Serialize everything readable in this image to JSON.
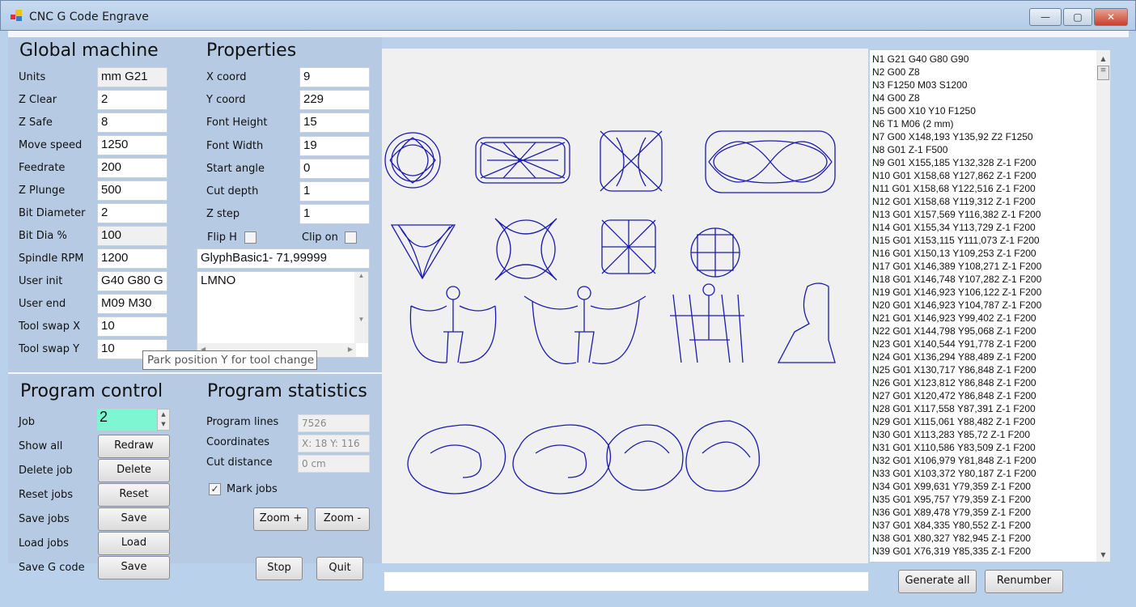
{
  "window": {
    "title": "CNC G Code Engrave",
    "minimize": "—",
    "maximize": "▢",
    "close": "✕"
  },
  "global": {
    "heading": "Global machine",
    "fields": [
      {
        "label": "Units",
        "value": "mm G21",
        "readonly": true
      },
      {
        "label": "Z Clear",
        "value": "2"
      },
      {
        "label": "Z Safe",
        "value": "8"
      },
      {
        "label": "Move speed",
        "value": "1250"
      },
      {
        "label": "Feedrate",
        "value": "200"
      },
      {
        "label": "Z Plunge",
        "value": "500"
      },
      {
        "label": "Bit Diameter",
        "value": "2"
      },
      {
        "label": "Bit Dia %",
        "value": "100",
        "readonly": true
      },
      {
        "label": "Spindle RPM",
        "value": "1200"
      },
      {
        "label": "User init",
        "value": "G40 G80 G"
      },
      {
        "label": "User end",
        "value": "M09 M30"
      },
      {
        "label": "Tool swap X",
        "value": "10"
      },
      {
        "label": "Tool swap Y",
        "value": "10"
      }
    ]
  },
  "properties": {
    "heading": "Properties",
    "fields": [
      {
        "label": "X coord",
        "value": "9"
      },
      {
        "label": "Y coord",
        "value": "229"
      },
      {
        "label": "Font Height",
        "value": "15"
      },
      {
        "label": "Font Width",
        "value": "19"
      },
      {
        "label": "Start angle",
        "value": "0"
      },
      {
        "label": "Cut depth",
        "value": "1"
      },
      {
        "label": "Z step",
        "value": "1"
      }
    ],
    "flip_h": {
      "label": "Flip H",
      "checked": false
    },
    "clip_on": {
      "label": "Clip on",
      "checked": false
    },
    "glyph": "GlyphBasic1- 71,99999",
    "text": "LMNO"
  },
  "tooltip": "Park position Y for tool change",
  "control": {
    "heading": "Program control",
    "job_label": "Job",
    "job_value": "2",
    "rows": [
      {
        "label": "Show all",
        "button": "Redraw"
      },
      {
        "label": "Delete job",
        "button": "Delete"
      },
      {
        "label": "Reset jobs",
        "button": "Reset"
      },
      {
        "label": "Save jobs",
        "button": "Save"
      },
      {
        "label": "Load jobs",
        "button": "Load"
      },
      {
        "label": "Save G code",
        "button": "Save"
      }
    ]
  },
  "stats": {
    "heading": "Program statistics",
    "rows": [
      {
        "label": "Program lines",
        "value": "7526"
      },
      {
        "label": "Coordinates",
        "value": "X: 18  Y: 116"
      },
      {
        "label": "Cut distance",
        "value": "0 cm"
      }
    ],
    "mark_jobs": {
      "label": "Mark jobs",
      "checked": true
    },
    "zoom_in": "Zoom +",
    "zoom_out": "Zoom -",
    "stop": "Stop",
    "quit": "Quit"
  },
  "drawing_color": "#1b1baf",
  "gcode": [
    "N1 G21 G40 G80 G90",
    "N2 G00 Z8",
    "N3  F1250 M03 S1200",
    "N4 G00 Z8",
    "N5 G00 X10 Y10 F1250",
    "N6 T1 M06 (2 mm)",
    "N7 G00 X148,193 Y135,92 Z2 F1250",
    "N8 G01 Z-1 F500",
    "N9 G01 X155,185 Y132,328 Z-1 F200",
    "N10 G01 X158,68 Y127,862 Z-1 F200",
    "N11 G01 X158,68 Y122,516 Z-1 F200",
    "N12 G01 X158,68 Y119,312 Z-1 F200",
    "N13 G01 X157,569 Y116,382 Z-1 F200",
    "N14 G01 X155,34 Y113,729 Z-1 F200",
    "N15 G01 X153,115 Y111,073 Z-1 F200",
    "N16 G01 X150,13 Y109,253 Z-1 F200",
    "N17 G01 X146,389 Y108,271 Z-1 F200",
    "N18 G01 X146,748 Y107,282 Z-1 F200",
    "N19 G01 X146,923 Y106,122 Z-1 F200",
    "N20 G01 X146,923 Y104,787 Z-1 F200",
    "N21 G01 X146,923 Y99,402 Z-1 F200",
    "N22 G01 X144,798 Y95,068 Z-1 F200",
    "N23 G01 X140,544 Y91,778 Z-1 F200",
    "N24 G01 X136,294 Y88,489 Z-1 F200",
    "N25 G01 X130,717 Y86,848 Z-1 F200",
    "N26 G01 X123,812 Y86,848 Z-1 F200",
    "N27 G01 X120,472 Y86,848 Z-1 F200",
    "N28 G01 X117,558 Y87,391 Z-1 F200",
    "N29 G01 X115,061 Y88,482 Z-1 F200",
    "N30 G01 X113,283 Y85,72 Z-1 F200",
    "N31 G01 X110,586 Y83,509 Z-1 F200",
    "N32 G01 X106,979 Y81,848 Z-1 F200",
    "N33 G01 X103,372 Y80,187 Z-1 F200",
    "N34 G01 X99,631 Y79,359 Z-1 F200",
    "N35 G01 X95,757 Y79,359 Z-1 F200",
    "N36 G01 X89,478 Y79,359 Z-1 F200",
    "N37 G01 X84,335 Y80,552 Z-1 F200",
    "N38 G01 X80,327 Y82,945 Z-1 F200",
    "N39 G01 X76,319 Y85,335 Z-1 F200"
  ],
  "command_input": "",
  "generate_all": "Generate all",
  "renumber": "Renumber"
}
